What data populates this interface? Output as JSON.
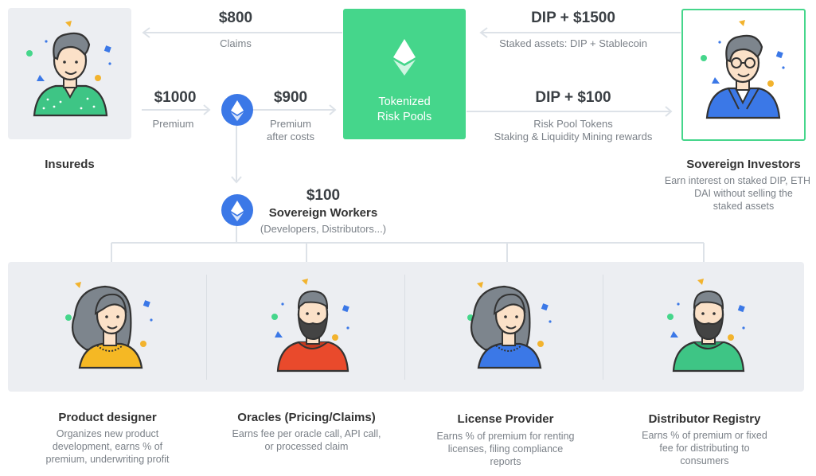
{
  "insureds": {
    "label": "Insureds"
  },
  "claims": {
    "amount": "$800",
    "label": "Claims"
  },
  "premium": {
    "amount": "$1000",
    "label": "Premium"
  },
  "premium_after_costs": {
    "amount": "$900",
    "line1": "Premium",
    "line2": "after costs"
  },
  "risk_pools": {
    "line1": "Tokenized",
    "line2": "Risk Pools"
  },
  "staked_assets": {
    "amount": "DIP + $1500",
    "label": "Staked assets: DIP + Stablecoin"
  },
  "rewards": {
    "amount": "DIP + $100",
    "line1": "Risk Pool Tokens",
    "line2": "Staking & Liquidity Mining rewards"
  },
  "investors": {
    "title": "Sovereign Investors",
    "line1": "Earn interest on staked DIP, ETH",
    "line2": "DAI without selling the",
    "line3": "staked assets"
  },
  "workers": {
    "amount": "$100",
    "title": "Sovereign Workers",
    "subtitle": "(Developers, Distributors...)"
  },
  "roles": [
    {
      "title": "Product designer",
      "line1": "Organizes new product",
      "line2": "development, earns % of",
      "line3": "premium, underwriting profit"
    },
    {
      "title": "Oracles (Pricing/Claims)",
      "line1": "Earns fee per oracle call, API call,",
      "line2": "or processed claim",
      "line3": ""
    },
    {
      "title": "License Provider",
      "line1": "Earns % of premium for renting",
      "line2": "licenses, filing compliance",
      "line3": "reports"
    },
    {
      "title": "Distributor Registry",
      "line1": "Earns % of premium or fixed",
      "line2": "fee for distributing to",
      "line3": "consumers"
    }
  ],
  "colors": {
    "green": "#45d68b",
    "blue": "#3b78e7",
    "card": "#eceef2",
    "arrow": "#dde2e8"
  }
}
